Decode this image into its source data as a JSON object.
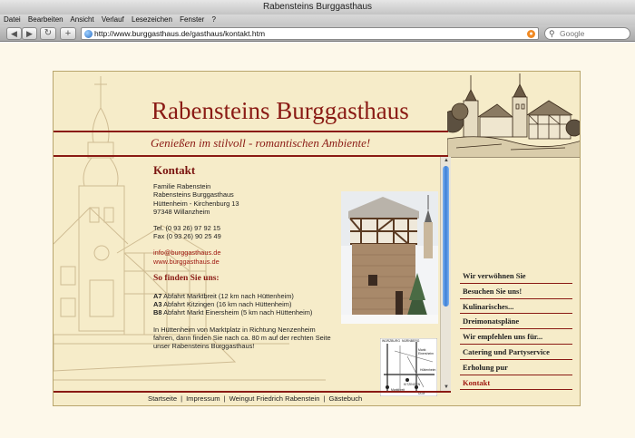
{
  "window": {
    "title": "Rabensteins  Burggasthaus"
  },
  "menu": [
    "Datei",
    "Bearbeiten",
    "Ansicht",
    "Verlauf",
    "Lesezeichen",
    "Fenster",
    "?"
  ],
  "toolbar": {
    "back_icon": "back-arrow-icon",
    "forward_icon": "forward-arrow-icon",
    "reload_icon": "reload-icon",
    "add_icon": "plus-icon",
    "url": "http://www.burggasthaus.de/gasthaus/kontakt.htm",
    "search_placeholder": "Google"
  },
  "site": {
    "title": "Rabensteins Burggasthaus",
    "tagline": "Genießen im stilvoll - romantischen Ambiente!"
  },
  "contact": {
    "heading": "Kontakt",
    "address": [
      "Familie Rabenstein",
      "Rabensteins Burggasthaus",
      "Hüttenheim - Kirchenburg 13",
      "97348 Willanzheim"
    ],
    "tel": "Tel. (0 93 26) 97 92 15",
    "fax": "Fax (0 93 26) 90 25 49",
    "email": "info@burggasthaus.de",
    "web": "www.burggasthaus.de",
    "directions_heading": "So finden Sie uns:",
    "directions": [
      {
        "road": "A7",
        "text": " Abfahrt Marktbreit (12 km nach Hüttenheim)"
      },
      {
        "road": "A3",
        "text": " Abfahrt Kitzingen (16 km nach Hüttenheim)"
      },
      {
        "road": "B8",
        "text": " Abfahrt Markt Einersheim (5 km nach Hüttenheim)"
      }
    ],
    "note": [
      "In Hüttenheim von Marktplatz in Richtung Nenzenheim",
      "fahren, dann finden Sie nach ca. 80 m auf der rechten Seite",
      "unser Rabensteins Burggasthaus!"
    ]
  },
  "nav": [
    {
      "label": "Wir verwöhnen Sie",
      "active": false
    },
    {
      "label": "Besuchen Sie uns!",
      "active": false
    },
    {
      "label": "Kulinarisches...",
      "active": false
    },
    {
      "label": "Dreimonatspläne",
      "active": false
    },
    {
      "label": "Wir empfehlen uns für...",
      "active": false
    },
    {
      "label": "Catering und Partyservice",
      "active": false
    },
    {
      "label": "Erholung pur",
      "active": false
    },
    {
      "label": "Kontakt",
      "active": true
    }
  ],
  "footer": [
    "Startseite",
    "Impressum",
    "Weingut Friedrich Rabenstein",
    "Gästebuch"
  ],
  "map_labels": {
    "wuerzburg": "WÜRZBURG",
    "kitzingen": "KITZINGEN",
    "nuernberg": "NÜRNBERG",
    "markt": "Markt",
    "einersheim": "Einersheim",
    "huettenheim": "Hüttenheim",
    "marktbreit": "Marktbreit",
    "ulm": "ULM"
  },
  "colors": {
    "brand": "#8a1a14",
    "background": "#f6ecc9",
    "page": "#fdf8ea",
    "scroll_thumb": "#3d7fd6"
  }
}
